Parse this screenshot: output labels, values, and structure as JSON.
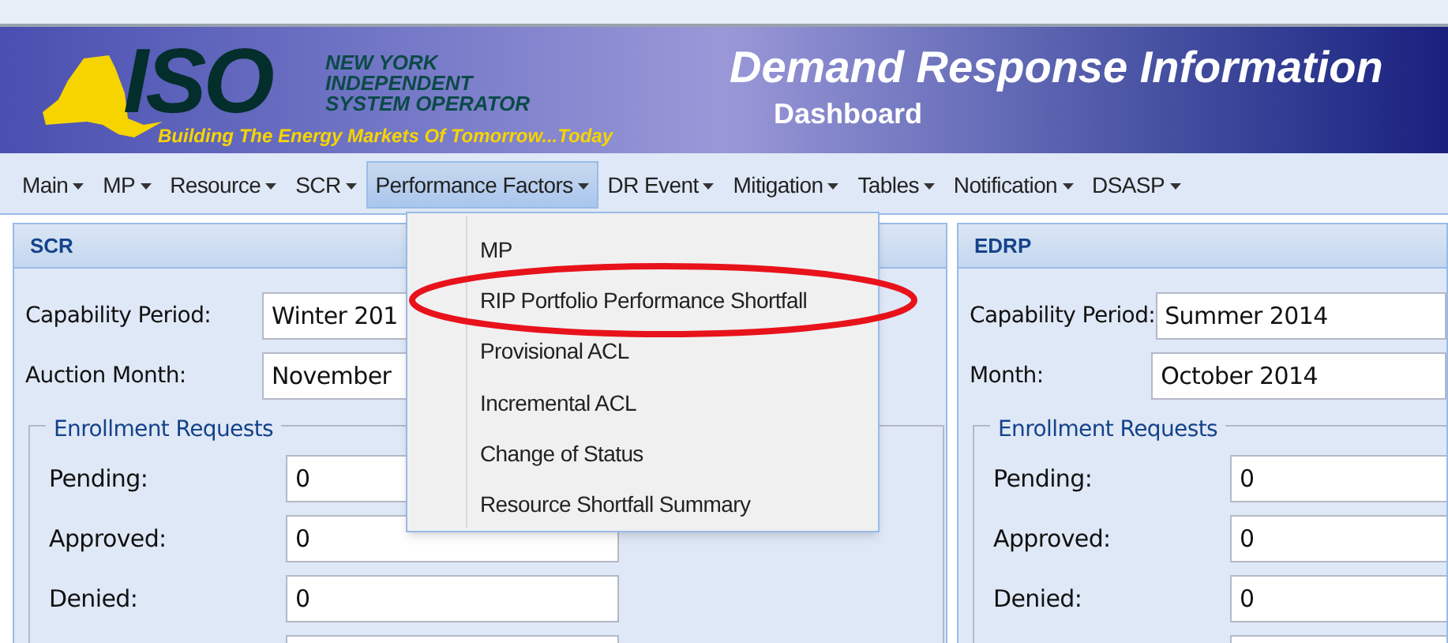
{
  "banner": {
    "logo": {
      "mark": "ISO",
      "name_lines": [
        "NEW YORK",
        "INDEPENDENT",
        "SYSTEM OPERATOR"
      ],
      "tagline": "Building The Energy Markets Of Tomorrow...Today"
    },
    "title": "Demand Response Information",
    "subtitle": "Dashboard"
  },
  "menu_bar": [
    {
      "label": "Main",
      "selected": false
    },
    {
      "label": "MP",
      "selected": false
    },
    {
      "label": "Resource",
      "selected": false
    },
    {
      "label": "SCR",
      "selected": false
    },
    {
      "label": "Performance Factors",
      "selected": true
    },
    {
      "label": "DR Event",
      "selected": false
    },
    {
      "label": "Mitigation",
      "selected": false
    },
    {
      "label": "Tables",
      "selected": false
    },
    {
      "label": "Notification",
      "selected": false
    },
    {
      "label": "DSASP",
      "selected": false
    }
  ],
  "dropdown": {
    "items": [
      {
        "label": "MP",
        "circled": false
      },
      {
        "label": "RIP Portfolio Performance Shortfall",
        "circled": true
      },
      {
        "label": "Provisional ACL",
        "circled": false
      },
      {
        "label": "Incremental ACL",
        "circled": false
      },
      {
        "label": "Change of Status",
        "circled": false
      },
      {
        "label": "Resource Shortfall Summary",
        "circled": false
      }
    ]
  },
  "panels": [
    {
      "title": "SCR",
      "fields": [
        {
          "label": "Capability Period:",
          "value": "Winter 201"
        },
        {
          "label": "Auction Month:",
          "value": "November"
        }
      ],
      "fieldset": {
        "legend": "Enrollment Requests",
        "fields": [
          {
            "label": "Pending:",
            "value": "0"
          },
          {
            "label": "Approved:",
            "value": "0"
          },
          {
            "label": "Denied:",
            "value": "0"
          }
        ]
      }
    },
    {
      "title": "EDRP",
      "fields": [
        {
          "label": "Capability Period:",
          "value": "Summer 2014"
        },
        {
          "label": "Month:",
          "value": "October 2014"
        }
      ],
      "fieldset": {
        "legend": "Enrollment Requests",
        "fields": [
          {
            "label": "Pending:",
            "value": "0"
          },
          {
            "label": "Approved:",
            "value": "0"
          },
          {
            "label": "Denied:",
            "value": "0"
          }
        ]
      }
    }
  ]
}
